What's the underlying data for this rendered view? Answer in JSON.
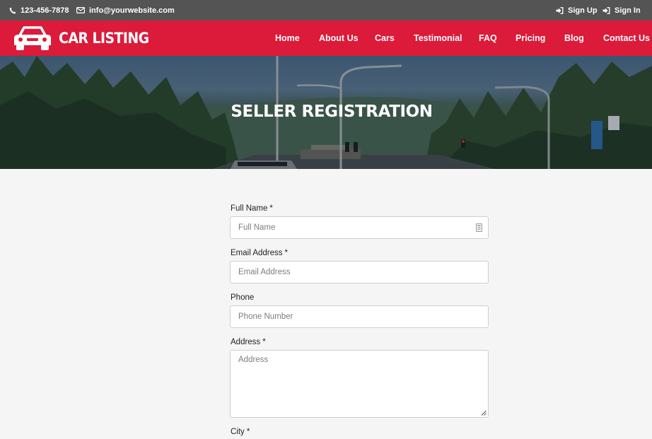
{
  "topbar": {
    "phone": "123-456-7878",
    "email": "info@yourwebsite.com",
    "sign_up": "Sign Up",
    "sign_in": "Sign In"
  },
  "brand": {
    "name": "CAR LISTING"
  },
  "nav": {
    "home": "Home",
    "about": "About Us",
    "cars": "Cars",
    "testimonial": "Testimonial",
    "faq": "FAQ",
    "pricing": "Pricing",
    "blog": "Blog",
    "contact": "Contact Us"
  },
  "hero": {
    "title": "SELLER REGISTRATION"
  },
  "form": {
    "required_marker": "*",
    "full_name": {
      "label": "Full Name",
      "placeholder": "Full Name"
    },
    "email": {
      "label": "Email Address",
      "placeholder": "Email Address"
    },
    "phone": {
      "label": "Phone",
      "placeholder": "Phone Number"
    },
    "address": {
      "label": "Address",
      "placeholder": "Address"
    },
    "city": {
      "label": "City"
    }
  },
  "colors": {
    "topbar": "#545454",
    "brand_red": "#dc1a3a",
    "page_bg": "#f5f5f5"
  }
}
